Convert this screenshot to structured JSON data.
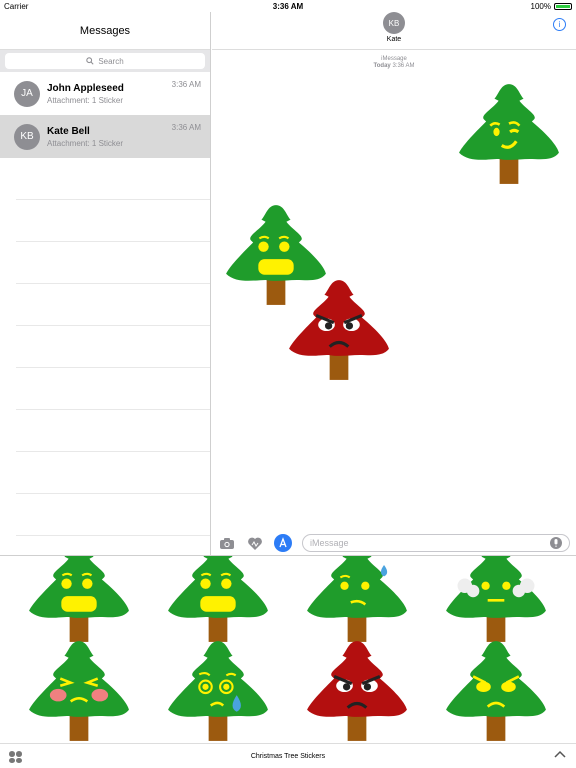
{
  "status": {
    "carrier": "Carrier",
    "time": "3:36 AM",
    "battery": "100%"
  },
  "sidebar": {
    "title": "Messages",
    "search_placeholder": "Search",
    "conversations": [
      {
        "initials": "JA",
        "name": "John Appleseed",
        "preview": "Attachment: 1 Sticker",
        "time": "3:36 AM"
      },
      {
        "initials": "KB",
        "name": "Kate Bell",
        "preview": "Attachment: 1 Sticker",
        "time": "3:36 AM"
      }
    ]
  },
  "chat": {
    "contact_initials": "KB",
    "contact_name": "Kate",
    "service": "iMessage",
    "day": "Today",
    "stamp_time": "3:36 AM",
    "input_placeholder": "iMessage"
  },
  "drawer": {
    "title": "Christmas Tree Stickers"
  },
  "stickers": {
    "chat": [
      {
        "color": "#1f9c2b",
        "face": "wink"
      },
      {
        "color": "#1f9c2b",
        "face": "shout"
      },
      {
        "color": "#b30f0f",
        "face": "angry"
      }
    ],
    "drawer": [
      {
        "color": "#1f9c2b",
        "face": "shout"
      },
      {
        "color": "#1f9c2b",
        "face": "shout"
      },
      {
        "color": "#1f9c2b",
        "face": "sweat"
      },
      {
        "color": "#1f9c2b",
        "face": "steam"
      },
      {
        "color": "#1f9c2b",
        "face": "blush"
      },
      {
        "color": "#1f9c2b",
        "face": "cry"
      },
      {
        "color": "#b30f0f",
        "face": "angry"
      },
      {
        "color": "#1f9c2b",
        "face": "frown"
      }
    ]
  }
}
